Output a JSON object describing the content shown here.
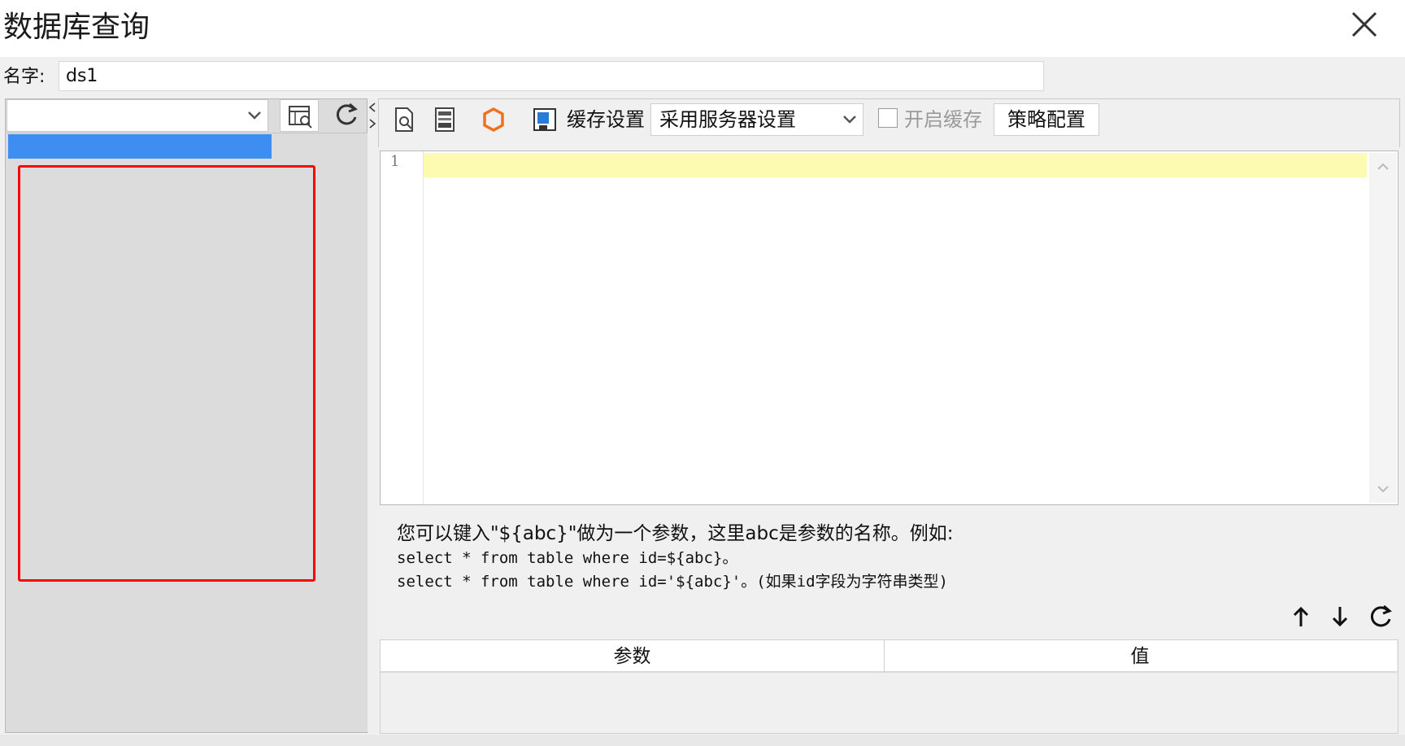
{
  "window": {
    "title": "数据库查询",
    "close_icon": "close-icon"
  },
  "name_row": {
    "label": "名字:",
    "value": "ds1"
  },
  "left_panel": {
    "connection_select_value": "",
    "icons": [
      "chevron-down-icon",
      "table-preview-icon",
      "refresh-icon"
    ],
    "selected_item_color": "#3d8ef0",
    "highlight_box_color": "#ff0000"
  },
  "toolbar": {
    "icons": [
      "preview-icon",
      "sql-file-icon",
      "hexagon-icon",
      "save-icon"
    ],
    "cache_label": "缓存设置",
    "cache_mode": "采用服务器设置",
    "enable_cache_label": "开启缓存",
    "enable_cache_checked": false,
    "strategy_button": "策略配置"
  },
  "editor": {
    "line_number": "1",
    "current_line_color": "#fdfbb2",
    "content": ""
  },
  "hint": {
    "line1": "您可以键入\"${abc}\"做为一个参数，这里abc是参数的名称。例如:",
    "line2": "select * from table where id=${abc}。",
    "line3": "select * from table where id='${abc}'。(如果id字段为字符串类型)"
  },
  "params": {
    "controls": [
      "arrow-up-icon",
      "arrow-down-icon",
      "refresh-icon"
    ],
    "columns": [
      "参数",
      "值"
    ]
  }
}
